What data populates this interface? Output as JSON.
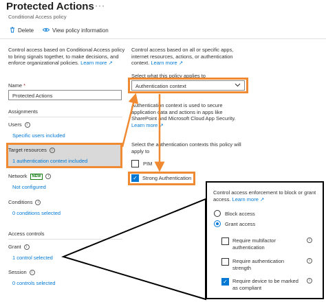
{
  "header": {
    "title": "Protected Actions",
    "subtitle": "Conditional Access policy",
    "ellipsis": "···"
  },
  "toolbar": {
    "delete_label": "Delete",
    "view_label": "View policy information"
  },
  "left": {
    "description": "Control access based on Conditional Access policy to bring signals together, to make decisions, and enforce organizational policies.",
    "learn_more": "Learn more",
    "name_label": "Name",
    "required_mark": "*",
    "name_value": "Protected Actions",
    "assignments_heading": "Assignments",
    "users_label": "Users",
    "users_value": "Specific users included",
    "target_label": "Target resources",
    "target_value": "1 authentication context included",
    "network_label": "Network",
    "network_badge": "NEW",
    "network_value": "Not configured",
    "conditions_label": "Conditions",
    "conditions_value": "0 conditions selected",
    "access_controls_heading": "Access controls",
    "grant_label": "Grant",
    "grant_value": "1 control selected",
    "session_label": "Session",
    "session_value": "0 controls selected"
  },
  "right": {
    "description": "Control access based on all or specific apps, internet resources, actions, or authentication context.",
    "learn_more": "Learn more",
    "applies_label": "Select what this policy applies to",
    "applies_value": "Authentication context",
    "context_description": "Authentication context is used to secure application data and actions in apps like SharePoint and Microsoft Cloud App Security.",
    "context_learn_more": "Learn more",
    "select_contexts_label": "Select the authentication contexts this policy will apply to",
    "contexts": [
      {
        "label": "PIM",
        "checked": false
      },
      {
        "label": "Strong Authentication",
        "checked": true
      }
    ]
  },
  "grant_popup": {
    "description": "Control access enforcement to block or grant access.",
    "learn_more": "Learn more",
    "options": [
      {
        "label": "Block access",
        "selected": false
      },
      {
        "label": "Grant access",
        "selected": true
      }
    ],
    "controls": [
      {
        "label": "Require multifactor authentication",
        "checked": false
      },
      {
        "label": "Require authentication strength",
        "checked": false
      },
      {
        "label": "Require device to be marked as compliant",
        "checked": true
      }
    ]
  },
  "colors": {
    "accent": "#0078d4",
    "highlight": "#f08a32",
    "selected_bg": "#d9d9d9",
    "new_badge": "#107c10"
  },
  "icons": {
    "delete": "trash-icon",
    "view": "eye-icon",
    "info": "info-icon",
    "external": "external-link-icon",
    "dropdown": "chevron-down-icon",
    "check": "checkmark-icon"
  }
}
